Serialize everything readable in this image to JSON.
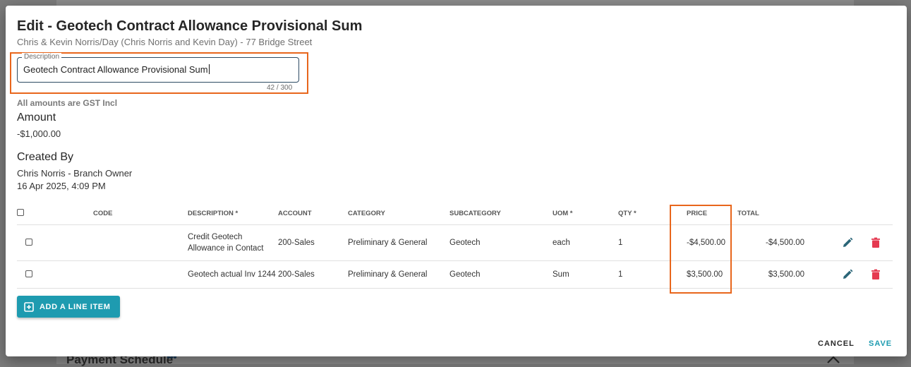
{
  "backdrop": {
    "heading": "Payment Schedule",
    "dots": "•••"
  },
  "modal": {
    "title": "Edit - Geotech Contract Allowance Provisional Sum",
    "subtitle": "Chris & Kevin Norris/Day (Chris Norris and Kevin Day) - 77 Bridge Street"
  },
  "description": {
    "legend": "Description",
    "value": "Geotech Contract Allowance Provisional Sum",
    "counter": "42 / 300"
  },
  "gst_note": "All amounts are GST Incl",
  "amount": {
    "label": "Amount",
    "value": "-$1,000.00"
  },
  "created_by": {
    "label": "Created By",
    "name": "Chris Norris - Branch Owner",
    "date": "16 Apr 2025, 4:09 PM"
  },
  "table": {
    "headers": {
      "code": "CODE",
      "description": "DESCRIPTION *",
      "account": "ACCOUNT",
      "category": "CATEGORY",
      "subcategory": "SUBCATEGORY",
      "uom": "UOM *",
      "qty": "QTY *",
      "price": "PRICE",
      "total": "TOTAL"
    },
    "rows": [
      {
        "code": "",
        "description_line1": "Credit Geotech",
        "description_line2": "Allowance in Contact",
        "account": "200-Sales",
        "category": "Preliminary & General",
        "subcategory": "Geotech",
        "uom": "each",
        "qty": "1",
        "price": "-$4,500.00",
        "total": "-$4,500.00"
      },
      {
        "code": "",
        "description_line1": "Geotech actual Inv 1244",
        "description_line2": "",
        "account": "200-Sales",
        "category": "Preliminary & General",
        "subcategory": "Geotech",
        "uom": "Sum",
        "qty": "1",
        "price": "$3,500.00",
        "total": "$3,500.00"
      }
    ]
  },
  "buttons": {
    "add_line_item": "ADD A LINE ITEM",
    "cancel": "CANCEL",
    "save": "SAVE"
  },
  "colors": {
    "accent": "#1e9bb0",
    "highlight": "#e8661c",
    "delete": "#e53950",
    "edit": "#2b6678"
  },
  "icons": [
    "add-box-icon",
    "pencil-icon",
    "trash-icon",
    "chevron-up-icon"
  ]
}
